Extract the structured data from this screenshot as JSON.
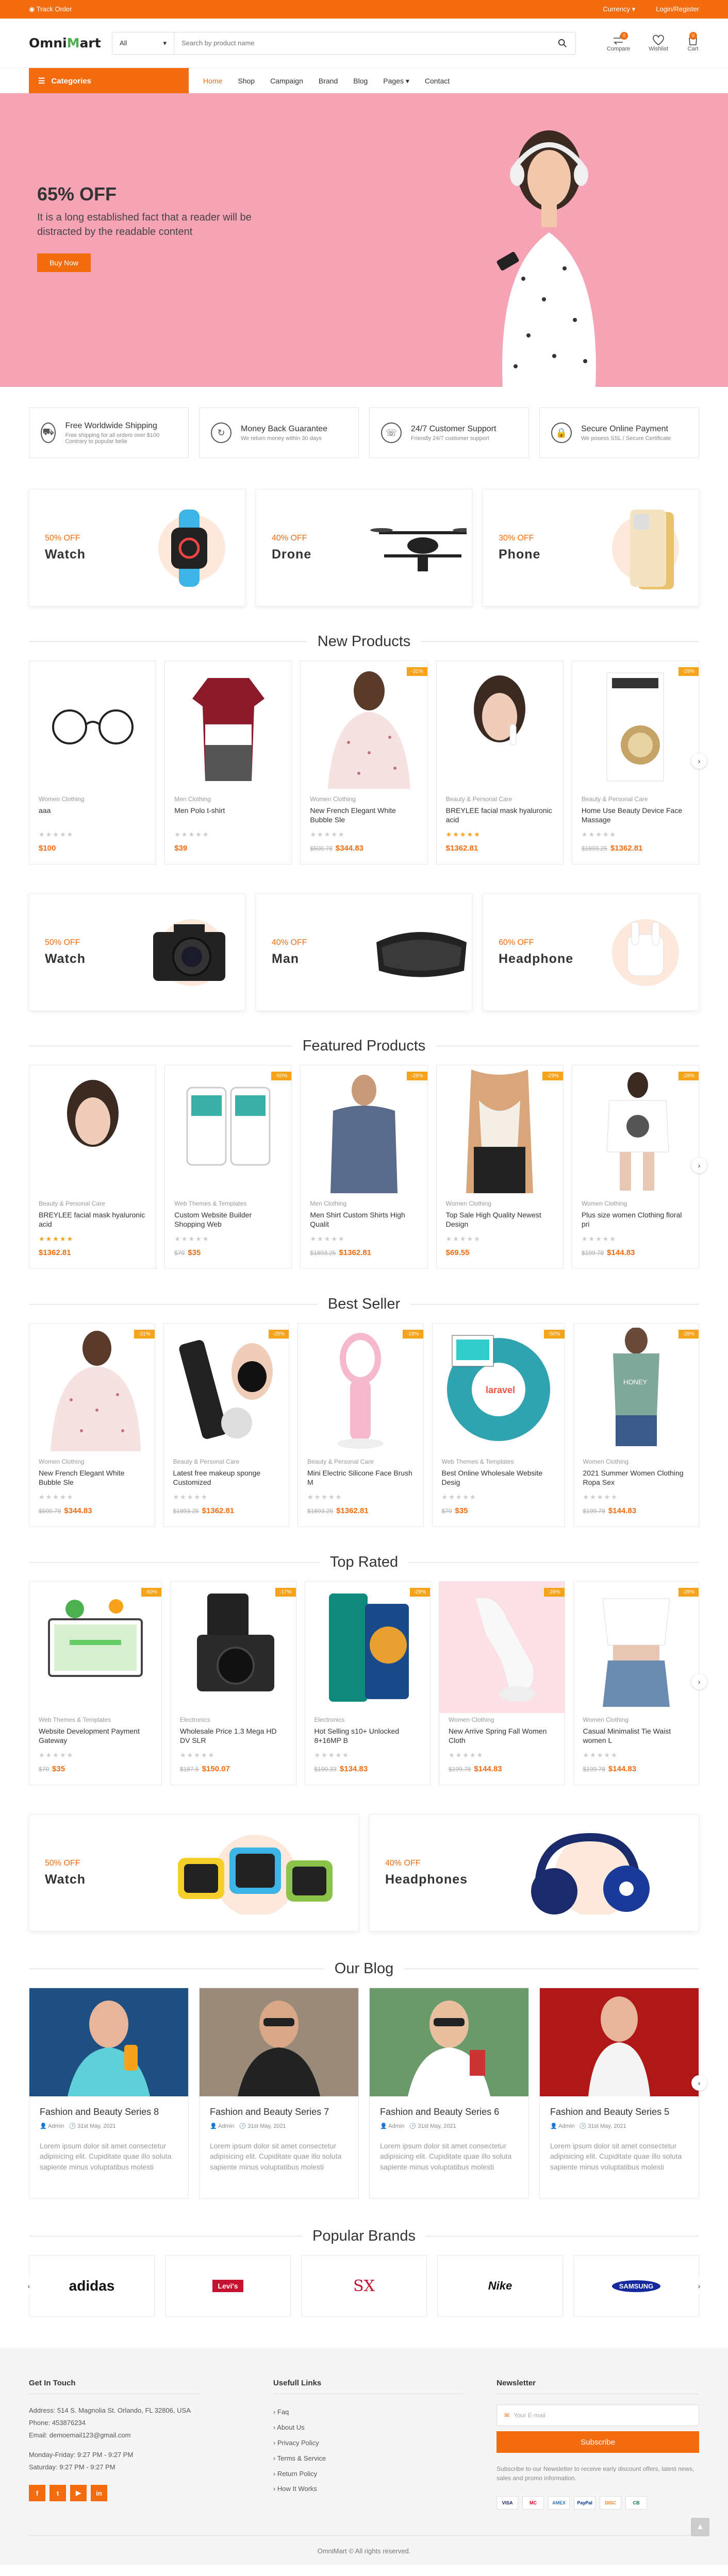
{
  "topbar": {
    "track_order": "Track Order",
    "currency": "Currency",
    "auth": "Login/Register"
  },
  "header": {
    "logo_pre": "Omni",
    "logo_post": "art",
    "category_select": "All",
    "search_placeholder": "Search by product name",
    "compare_label": "Compare",
    "compare_count": "0",
    "wishlist_label": "Wishlist",
    "cart_label": "Cart",
    "cart_count": "0"
  },
  "nav": {
    "categories": "Categories",
    "items": [
      "Home",
      "Shop",
      "Campaign",
      "Brand",
      "Blog",
      "Pages",
      "Contact"
    ]
  },
  "hero": {
    "headline": "65% OFF",
    "text": "It is a long established fact that a reader will be distracted by the readable content",
    "button": "Buy Now"
  },
  "features": [
    {
      "icon": "truck-icon",
      "title": "Free Worldwide Shipping",
      "sub": "Free shipping for all orders over $100 Contrary to popular belie"
    },
    {
      "icon": "refresh-icon",
      "title": "Money Back Guarantee",
      "sub": "We return money within 30 days"
    },
    {
      "icon": "headset-icon",
      "title": "24/7 Customer Support",
      "sub": "Friendly 24/7 customer support"
    },
    {
      "icon": "lock-icon",
      "title": "Secure Online Payment",
      "sub": "We posess SSL / Secure Certificate"
    }
  ],
  "promos1": [
    {
      "off": "50% OFF",
      "name": "Watch"
    },
    {
      "off": "40% OFF",
      "name": "Drone"
    },
    {
      "off": "30% OFF",
      "name": "Phone"
    }
  ],
  "new_products": {
    "title": "New Products",
    "items": [
      {
        "cat": "Women Clothing",
        "title": "aaa",
        "old": "",
        "price": "$100",
        "badge": ""
      },
      {
        "cat": "Men Clothing",
        "title": "Men Polo t-shirt",
        "old": "",
        "price": "$39",
        "badge": ""
      },
      {
        "cat": "Women Clothing",
        "title": "New French Elegant White Bubble Sle",
        "old": "$500.78",
        "price": "$344.83",
        "badge": "-31%"
      },
      {
        "cat": "Beauty & Personal Care",
        "title": "BREYLEE facial mask hyaluronic acid",
        "old": "",
        "price": "$1362.81",
        "badge": ""
      },
      {
        "cat": "Beauty & Personal Care",
        "title": "Home Use Beauty Device Face Massage",
        "old": "$1893.25",
        "price": "$1362.81",
        "badge": "-28%"
      }
    ]
  },
  "promos2": [
    {
      "off": "50% OFF",
      "name": "Watch"
    },
    {
      "off": "40% OFF",
      "name": "Man"
    },
    {
      "off": "60% OFF",
      "name": "Headphone"
    }
  ],
  "featured": {
    "title": "Featured Products",
    "items": [
      {
        "cat": "Beauty & Personal Care",
        "title": "BREYLEE facial mask hyaluronic acid",
        "old": "",
        "price": "$1362.81",
        "badge": ""
      },
      {
        "cat": "Web Themes & Templates",
        "title": "Custom Website Builder Shopping Web",
        "old": "$70",
        "price": "$35",
        "badge": "-50%"
      },
      {
        "cat": "Men Clothing",
        "title": "Men Shirt Custom Shirts High Qualit",
        "old": "$1893.25",
        "price": "$1362.81",
        "badge": "-28%"
      },
      {
        "cat": "Women Clothing",
        "title": "Top Sale High Quality Newest Design",
        "old": "",
        "price": "$69.55",
        "badge": "-29%"
      },
      {
        "cat": "Women Clothing",
        "title": "Plus size women Clothing floral pri",
        "old": "$199.78",
        "price": "$144.83",
        "badge": "-28%"
      }
    ]
  },
  "best_seller": {
    "title": "Best Seller",
    "items": [
      {
        "cat": "Women Clothing",
        "title": "New French Elegant White Bubble Sle",
        "old": "$500.78",
        "price": "$344.83",
        "badge": "-31%"
      },
      {
        "cat": "Beauty & Personal Care",
        "title": "Latest free makeup sponge Customized",
        "old": "$1893.25",
        "price": "$1362.81",
        "badge": "-28%"
      },
      {
        "cat": "Beauty & Personal Care",
        "title": "Mini Electric Silicone Face Brush M",
        "old": "$1893.25",
        "price": "$1362.81",
        "badge": "-28%"
      },
      {
        "cat": "Web Themes & Templates",
        "title": "Best Online Wholesale Website Desig",
        "old": "$70",
        "price": "$35",
        "badge": "-50%"
      },
      {
        "cat": "Women Clothing",
        "title": "2021 Summer Women Clothing Ropa Sex",
        "old": "$199.78",
        "price": "$144.83",
        "badge": "-28%"
      }
    ]
  },
  "top_rated": {
    "title": "Top Rated",
    "items": [
      {
        "cat": "Web Themes & Templates",
        "title": "Website Development Payment Gateway",
        "old": "$70",
        "price": "$35",
        "badge": "-50%"
      },
      {
        "cat": "Electronics",
        "title": "Wholesale Price 1.3 Mega HD DV SLR",
        "old": "$187.5",
        "price": "$150.07",
        "badge": "-17%"
      },
      {
        "cat": "Electronics",
        "title": "Hot Selling s10+ Unlocked 8+16MP B",
        "old": "$190.33",
        "price": "$134.83",
        "badge": "-29%"
      },
      {
        "cat": "Women Clothing",
        "title": "New Arrive Spring Fall Women Cloth",
        "old": "$199.78",
        "price": "$144.83",
        "badge": "-28%"
      },
      {
        "cat": "Women Clothing",
        "title": "Casual Minimalist Tie Waist women L",
        "old": "$199.78",
        "price": "$144.83",
        "badge": "-28%"
      }
    ]
  },
  "promos3": [
    {
      "off": "50% OFF",
      "name": "Watch"
    },
    {
      "off": "40% OFF",
      "name": "Headphones"
    }
  ],
  "blog": {
    "title": "Our Blog",
    "items": [
      {
        "title": "Fashion and Beauty Series 8",
        "author": "Admin",
        "date": "31st May, 2021",
        "excerpt": "Lorem ipsum dolor sit amet consectetur adipisicing elit. Cupiditate quae illo soluta sapiente minus voluptatibus molesti"
      },
      {
        "title": "Fashion and Beauty Series 7",
        "author": "Admin",
        "date": "31st May, 2021",
        "excerpt": "Lorem ipsum dolor sit amet consectetur adipisicing elit. Cupiditate quae illo soluta sapiente minus voluptatibus molesti"
      },
      {
        "title": "Fashion and Beauty Series 6",
        "author": "Admin",
        "date": "31st May, 2021",
        "excerpt": "Lorem ipsum dolor sit amet consectetur adipisicing elit. Cupiditate quae illo soluta sapiente minus voluptatibus molesti"
      },
      {
        "title": "Fashion and Beauty Series 5",
        "author": "Admin",
        "date": "31st May, 2021",
        "excerpt": "Lorem ipsum dolor sit amet consectetur adipisicing elit. Cupiditate quae illo soluta sapiente minus voluptatibus molesti"
      }
    ]
  },
  "brands": {
    "title": "Popular Brands",
    "items": [
      "adidas",
      "Levi's",
      "SX",
      "Nike",
      "SAMSUNG"
    ]
  },
  "footer": {
    "contact_title": "Get In Touch",
    "address": "Address: 514 S. Magnolia St. Orlando, FL 32806, USA",
    "phone": "Phone: 453876234",
    "email": "Email: demoemail123@gmail.com",
    "hours1": "Monday-Friday: 9:27 PM - 9:27 PM",
    "hours2": "Saturday: 9:27 PM - 9:27 PM",
    "links_title": "Usefull Links",
    "links": [
      "Faq",
      "About Us",
      "Privacy Policy",
      "Terms & Service",
      "Return Policy",
      "How It Works"
    ],
    "newsletter_title": "Newsletter",
    "email_placeholder": "Your E-mail",
    "subscribe": "Subscribe",
    "newsletter_text": "Subscribe to our Newsletter to receive early discount offers, latest news, sales and promo information.",
    "payments": [
      "VISA",
      "MC",
      "AMEX",
      "PayPal",
      "DISC",
      "CB"
    ],
    "copyright": "OmniMart © All rights reserved."
  },
  "colors": {
    "accent": "#f36c10",
    "hero_bg": "#f7a3b6",
    "badge": "#f6a21a"
  }
}
